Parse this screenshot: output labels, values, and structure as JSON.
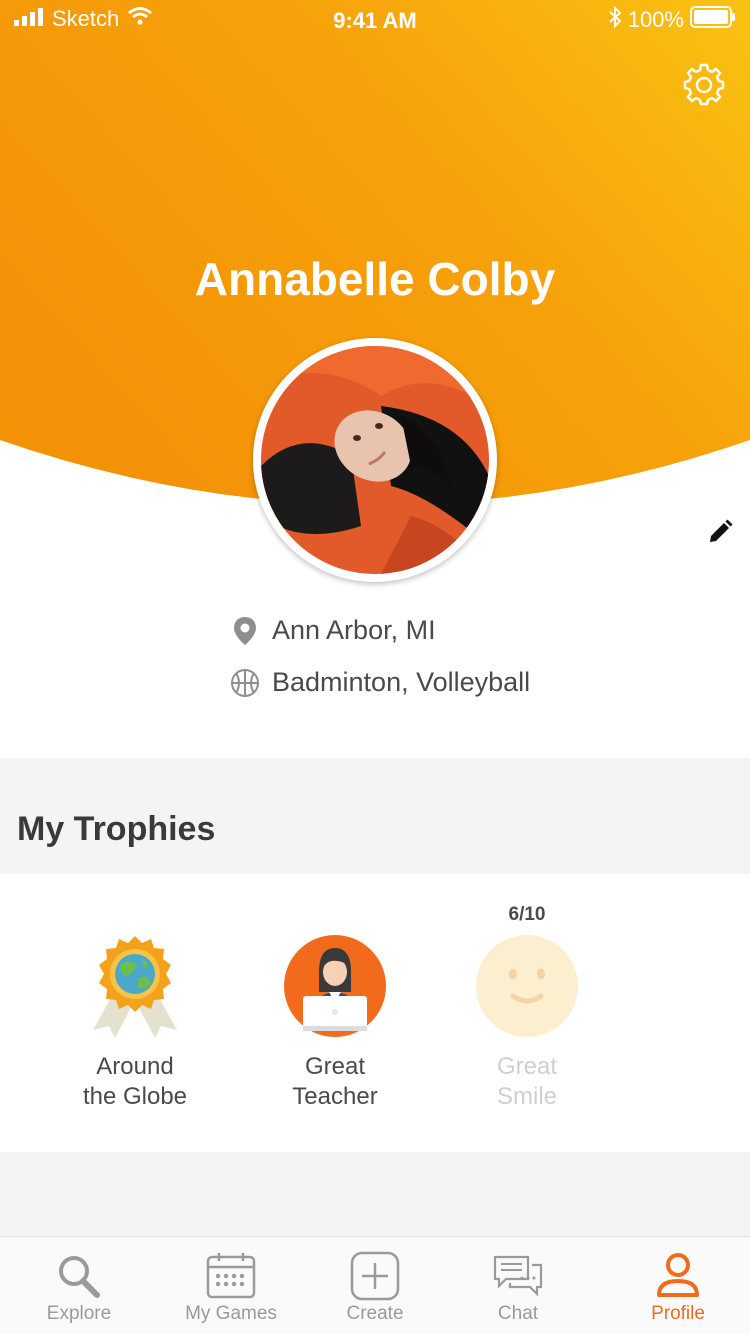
{
  "status_bar": {
    "carrier": "Sketch",
    "time": "9:41 AM",
    "battery": "100%"
  },
  "profile": {
    "name": "Annabelle Colby",
    "location": "Ann Arbor, MI",
    "sports": "Badminton, Volleyball"
  },
  "trophies": {
    "title": "My Trophies",
    "items": [
      {
        "line1": "Around",
        "line2": "the Globe",
        "icon": "globe-medal-icon",
        "earned": true
      },
      {
        "line1": "Great",
        "line2": "Teacher",
        "icon": "teacher-icon",
        "earned": true
      },
      {
        "line1": "Great",
        "line2": "Smile",
        "icon": "smile-icon",
        "earned": false,
        "progress": "6/10"
      }
    ]
  },
  "tabs": [
    {
      "label": "Explore",
      "icon": "search-icon"
    },
    {
      "label": "My Games",
      "icon": "calendar-icon"
    },
    {
      "label": "Create",
      "icon": "plus-square-icon"
    },
    {
      "label": "Chat",
      "icon": "chat-icon"
    },
    {
      "label": "Profile",
      "icon": "user-icon",
      "active": true
    }
  ],
  "colors": {
    "accent": "#f26b1d",
    "header_orange": "#f7a00b",
    "header_yellow": "#f8bc10"
  }
}
